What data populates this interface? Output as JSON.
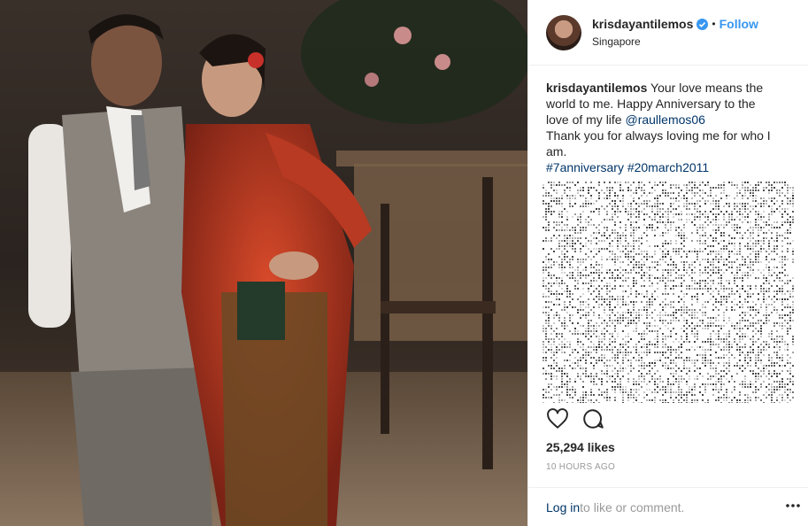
{
  "post": {
    "username": "krisdayantilemos",
    "verified": true,
    "separator": "•",
    "follow_label": "Follow",
    "location": "Singapore",
    "caption": {
      "username": "krisdayantilemos",
      "text1": " Your love means the world to me. Happy Anniversary to the love of my life ",
      "mention": "@raullemos06",
      "text2": "Thank you for always loving me for who I am.",
      "hashtag1": "#7anniversary",
      "hashtag2": "#20march2011"
    },
    "likes": "25,294 likes",
    "timestamp": "10 HOURS AGO",
    "footer": {
      "login": "Log in",
      "rest": " to like or comment."
    }
  },
  "icons": {
    "like": "heart-icon",
    "comment": "comment-icon",
    "more": "more-options-icon",
    "verified": "verified-badge-icon"
  },
  "colors": {
    "link": "#003569",
    "follow": "#3897f0",
    "muted": "#999999",
    "border": "#efefef"
  }
}
